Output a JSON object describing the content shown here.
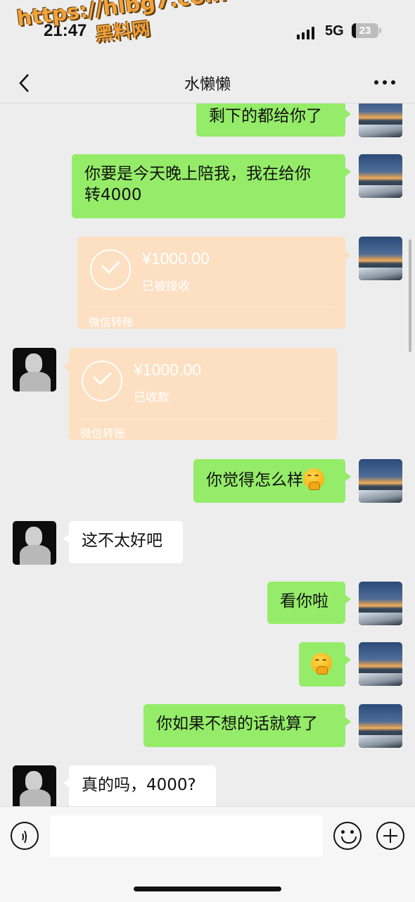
{
  "status_bar": {
    "time": "21:47",
    "network": "5G",
    "battery": "23"
  },
  "watermark": {
    "line1": "https://hlbg7.com",
    "line2": "黑料网"
  },
  "header": {
    "title": "水懒懒",
    "back_icon": "chevron-left-icon",
    "more_icon": "more-dots-icon"
  },
  "messages": [
    {
      "from": "self",
      "type": "text",
      "text": "剩下的都给你了"
    },
    {
      "from": "self",
      "type": "text",
      "line1": "你要是今天晚上陪我，我在给你",
      "line2": "转4000"
    },
    {
      "from": "self",
      "type": "transfer",
      "amount": "¥1000.00",
      "status": "已被接收",
      "label": "微信转账"
    },
    {
      "from": "other",
      "type": "transfer",
      "amount": "¥1000.00",
      "status": "已收款",
      "label": "微信转账"
    },
    {
      "from": "self",
      "type": "text",
      "text": "你觉得怎么样",
      "emoji": "hand-over-mouth-emoji"
    },
    {
      "from": "other",
      "type": "text",
      "text": "这不太好吧"
    },
    {
      "from": "self",
      "type": "text",
      "text": "看你啦"
    },
    {
      "from": "self",
      "type": "emoji",
      "emoji": "hand-over-mouth-emoji"
    },
    {
      "from": "self",
      "type": "text",
      "text": "你如果不想的话就算了"
    },
    {
      "from": "other",
      "type": "text",
      "text": "真的吗，4000?"
    }
  ],
  "input_bar": {
    "voice_icon": "voice-icon",
    "emoji_icon": "emoji-icon",
    "plus_icon": "plus-icon",
    "input_value": ""
  }
}
